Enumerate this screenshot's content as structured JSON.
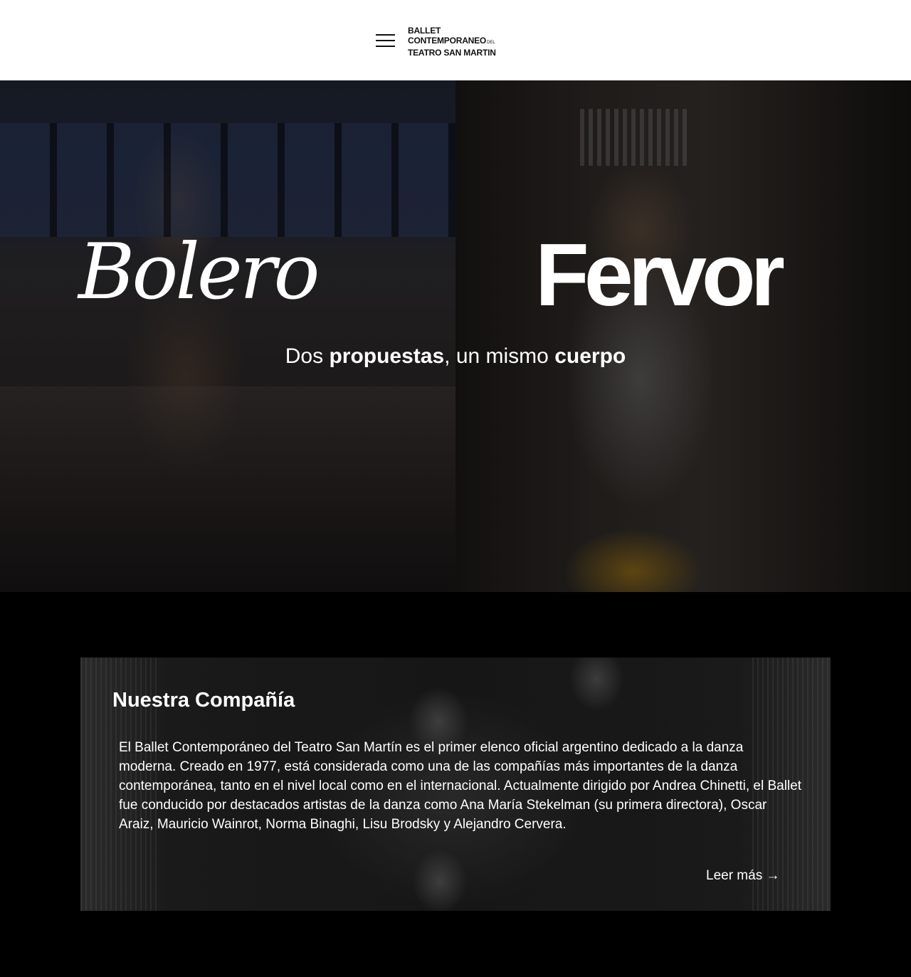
{
  "header": {
    "menu_icon": "hamburger-menu-icon",
    "logo": {
      "line1": "BALLET",
      "line2": "CONTEMPORANEO",
      "line2_small": "DEL",
      "line3": "TEATRO SAN MARTIN"
    }
  },
  "hero": {
    "left_title": "Bolero",
    "right_title": "Fervor",
    "subtitle": {
      "part1": "Dos ",
      "part2_bold": "propuestas",
      "part3": ", un mismo ",
      "part4_bold": "cuerpo"
    }
  },
  "company": {
    "title": "Nuestra Compañía",
    "text": "El Ballet Contemporáneo del Teatro San Martín es el primer elenco oficial argentino dedicado a la danza moderna. Creado en 1977, está considerada como una de las compañías más importantes de la danza contemporánea, tanto en el nivel local como en el internacional. Actualmente dirigido por Andrea Chinetti, el Ballet fue conducido por destacados artistas de la danza como Ana María Stekelman (su primera directora), Oscar Araiz, Mauricio Wainrot, Norma Binaghi, Lisu Brodsky y Alejandro Cervera.",
    "read_more": "Leer más →"
  },
  "colors": {
    "header_bg": "#ffffff",
    "page_bg": "#000000",
    "text_light": "#ffffff",
    "text_dark": "#111111"
  }
}
